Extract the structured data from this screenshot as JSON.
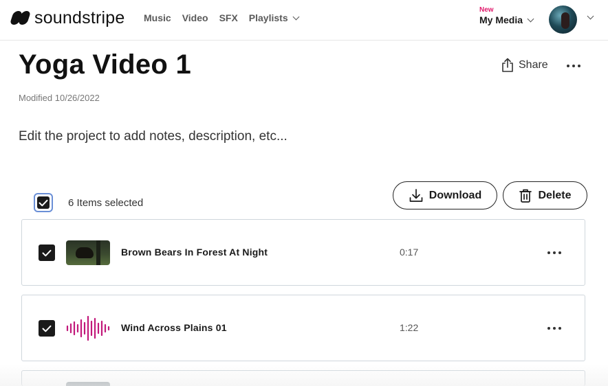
{
  "brand": {
    "name": "soundstripe"
  },
  "nav": {
    "items": [
      {
        "label": "Music"
      },
      {
        "label": "Video"
      },
      {
        "label": "SFX"
      },
      {
        "label": "Playlists"
      }
    ],
    "my_media_badge": "New",
    "my_media_label": "My Media"
  },
  "project": {
    "title": "Yoga Video 1",
    "modified": "Modified 10/26/2022",
    "description": "Edit the project to add notes, description, etc...",
    "share_label": "Share"
  },
  "selection": {
    "count_text": "6 Items selected",
    "download_label": "Download",
    "delete_label": "Delete"
  },
  "items": [
    {
      "name": "Brown Bears In Forest At Night",
      "duration": "0:17",
      "thumb": "video-thumbnail",
      "checked": true
    },
    {
      "name": "Wind Across Plains 01",
      "duration": "1:22",
      "thumb": "waveform-icon",
      "checked": true
    }
  ],
  "colors": {
    "accent_new": "#e0196b",
    "waveform": "#c2187a",
    "checkbox": "#1a1a1a",
    "focus_ring": "#6a8fd6"
  }
}
